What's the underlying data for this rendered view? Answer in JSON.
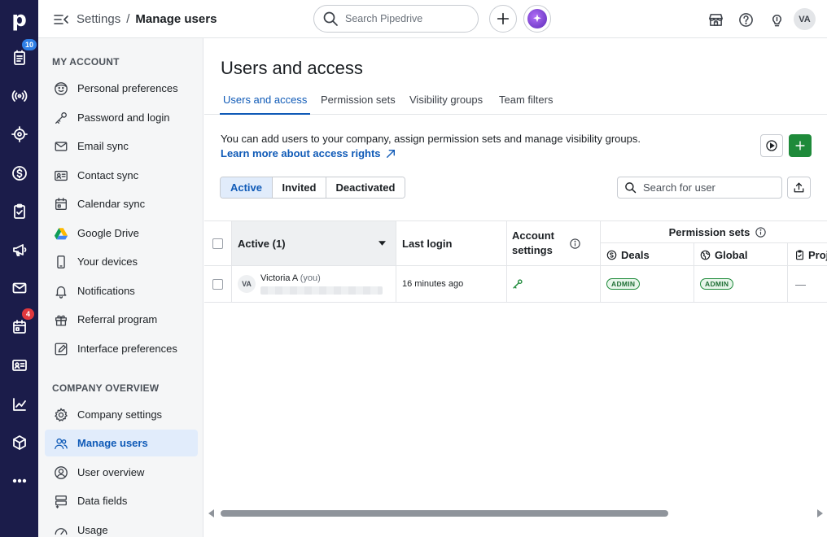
{
  "rail": {
    "logo": "p",
    "badges": {
      "activities": "10",
      "calendar": "4"
    },
    "colors": {
      "bg": "#1b1c4a",
      "badge_blue": "#2f7fe6",
      "badge_red": "#e0383e"
    }
  },
  "header": {
    "breadcrumb_parent": "Settings",
    "breadcrumb_sep": "/",
    "breadcrumb_current": "Manage users",
    "search_placeholder": "Search Pipedrive",
    "avatar_initials": "VA"
  },
  "sidebar": {
    "section_account": "MY ACCOUNT",
    "account_items": [
      {
        "label": "Personal preferences"
      },
      {
        "label": "Password and login"
      },
      {
        "label": "Email sync"
      },
      {
        "label": "Contact sync"
      },
      {
        "label": "Calendar sync"
      },
      {
        "label": "Google Drive"
      },
      {
        "label": "Your devices"
      },
      {
        "label": "Notifications"
      },
      {
        "label": "Referral program"
      },
      {
        "label": "Interface preferences"
      }
    ],
    "section_company": "COMPANY OVERVIEW",
    "company_items": [
      {
        "label": "Company settings"
      },
      {
        "label": "Manage users"
      },
      {
        "label": "User overview"
      },
      {
        "label": "Data fields"
      },
      {
        "label": "Usage"
      }
    ]
  },
  "main": {
    "title": "Users and access",
    "tabs": [
      {
        "label": "Users and access"
      },
      {
        "label": "Permission sets"
      },
      {
        "label": "Visibility groups"
      },
      {
        "label": "Team filters"
      }
    ],
    "description": "You can add users to your company, assign permission sets and manage visibility groups.",
    "learn_more": "Learn more about access rights",
    "filters": [
      {
        "label": "Active"
      },
      {
        "label": "Invited"
      },
      {
        "label": "Deactivated"
      }
    ],
    "user_search_placeholder": "Search for user",
    "table": {
      "col_active": "Active (1)",
      "col_last_login": "Last login",
      "col_account_settings_1": "Account",
      "col_account_settings_2": "settings",
      "col_permission_sets": "Permission sets",
      "col_deals": "Deals",
      "col_global": "Global",
      "col_projects": "Proje",
      "rows": [
        {
          "initials": "VA",
          "name": "Victoria A",
          "you": "(you)",
          "last_login": "16 minutes ago",
          "deals": "ADMIN",
          "global": "ADMIN",
          "projects": "—"
        }
      ]
    },
    "colors": {
      "accent": "#0f5ab7",
      "green": "#1e8a3a",
      "active_bg": "#e1ecfb"
    }
  }
}
